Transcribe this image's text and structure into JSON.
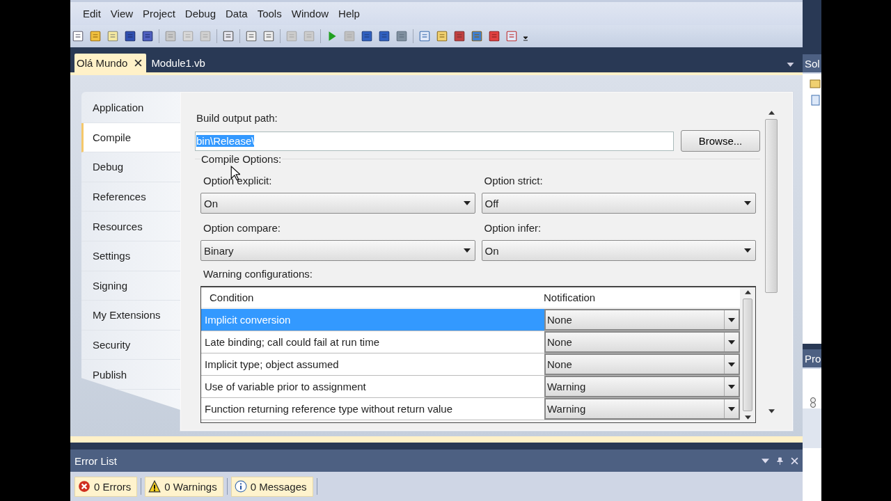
{
  "menu": [
    "Edit",
    "View",
    "Project",
    "Debug",
    "Data",
    "Tools",
    "Window",
    "Help"
  ],
  "doc_tabs": [
    {
      "label": "Olá Mundo",
      "selected": true
    },
    {
      "label": "Module1.vb",
      "selected": false
    }
  ],
  "side_tabs": [
    {
      "label": "Application",
      "selected": false
    },
    {
      "label": "Compile",
      "selected": true
    },
    {
      "label": "Debug",
      "selected": false
    },
    {
      "label": "References",
      "selected": false
    },
    {
      "label": "Resources",
      "selected": false
    },
    {
      "label": "Settings",
      "selected": false
    },
    {
      "label": "Signing",
      "selected": false
    },
    {
      "label": "My Extensions",
      "selected": false
    },
    {
      "label": "Security",
      "selected": false
    },
    {
      "label": "Publish",
      "selected": false
    }
  ],
  "build_output_path": {
    "label": "Build output path:",
    "value": "bin\\Release\\",
    "text_selected": true
  },
  "browse_button": "Browse...",
  "compile_options": {
    "title": "Compile Options:",
    "options": [
      {
        "label": "Option explicit:",
        "value": "On"
      },
      {
        "label": "Option strict:",
        "value": "Off"
      },
      {
        "label": "Option compare:",
        "value": "Binary"
      },
      {
        "label": "Option infer:",
        "value": "On"
      }
    ]
  },
  "warning_configurations": {
    "title": "Warning configurations:",
    "columns": [
      "Condition",
      "Notification"
    ],
    "rows": [
      {
        "condition": "Implicit conversion",
        "notification": "None",
        "selected": true
      },
      {
        "condition": "Late binding; call could fail at run time",
        "notification": "None",
        "selected": false
      },
      {
        "condition": "Implicit type; object assumed",
        "notification": "None",
        "selected": false
      },
      {
        "condition": "Use of variable prior to assignment",
        "notification": "Warning",
        "selected": false
      },
      {
        "condition": "Function returning reference type without return value",
        "notification": "Warning",
        "selected": false
      }
    ]
  },
  "error_list": {
    "title": "Error List",
    "filters": [
      {
        "kind": "error",
        "label": "0 Errors"
      },
      {
        "kind": "warning",
        "label": "0 Warnings"
      },
      {
        "kind": "info",
        "label": "0 Messages"
      }
    ]
  },
  "side_panels": [
    {
      "title": "Sol"
    },
    {
      "title": "Pro"
    }
  ]
}
